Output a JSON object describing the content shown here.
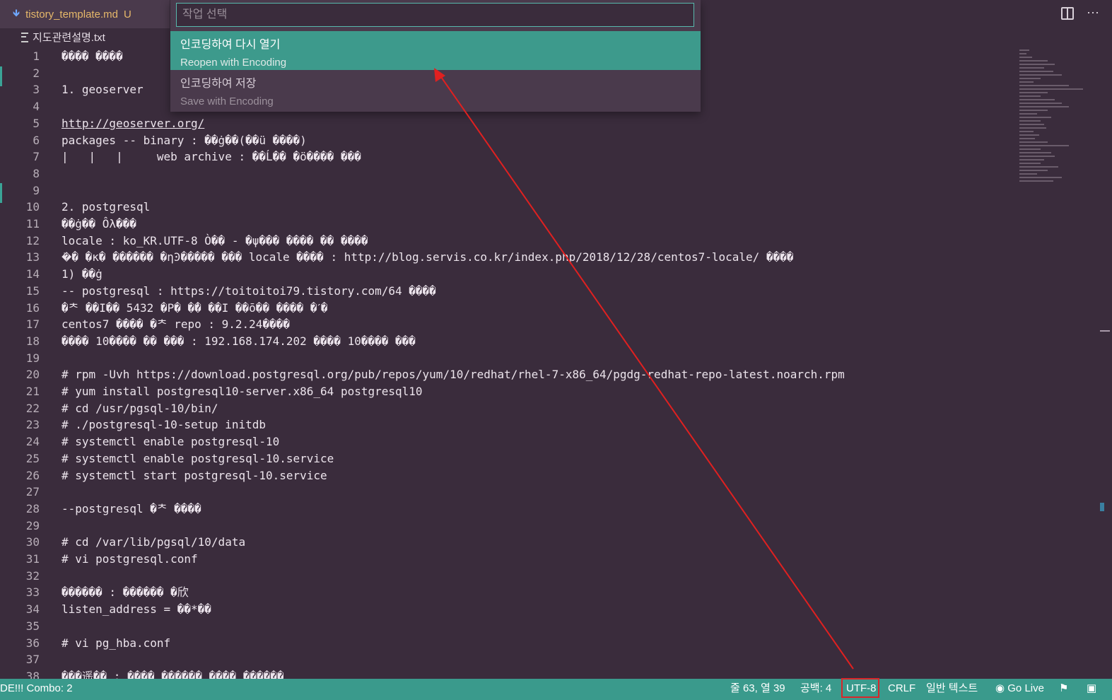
{
  "tab": {
    "filename": "tistory_template.md",
    "badge": "U",
    "icon": "download-arrow-icon"
  },
  "breadcrumb": {
    "filename": "지도관련설명.txt",
    "icon": "text-file-icon"
  },
  "quickpick": {
    "placeholder": "작업 선택",
    "items": [
      {
        "title": "인코딩하여 다시 열기",
        "description": "Reopen with Encoding",
        "selected": true
      },
      {
        "title": "인코딩하여 저장",
        "description": "Save with Encoding",
        "selected": false
      }
    ]
  },
  "editor": {
    "lines": [
      {
        "n": "1",
        "text": "���� ����"
      },
      {
        "n": "2",
        "text": ""
      },
      {
        "n": "3",
        "text": "1. geoserver"
      },
      {
        "n": "4",
        "text": ""
      },
      {
        "n": "5",
        "text": "http://geoserver.org/",
        "link": true
      },
      {
        "n": "6",
        "text": "packages -- binary : ��ġ��(��ü ����)"
      },
      {
        "n": "7",
        "text": "|   |   |     web archive : ��Ĺ�� �ö���� ���"
      },
      {
        "n": "8",
        "text": ""
      },
      {
        "n": "9",
        "text": ""
      },
      {
        "n": "10",
        "text": "2. postgresql"
      },
      {
        "n": "11",
        "text": "��ġ�� Ôλ���"
      },
      {
        "n": "12",
        "text": "locale : ko_KR.UTF-8 Ò�� - �ψ��� ���� �� ����"
      },
      {
        "n": "13",
        "text": "�ܰ� �κ� ������ �ηϿ����� ��� locale ���� : http://blog.servis.co.kr/index.php/2018/12/28/centos7-locale/ ����"
      },
      {
        "n": "14",
        "text": "1) ��ġ"
      },
      {
        "n": "15",
        "text": "-- postgresql : https://toitoitoi79.tistory.com/64 ����"
      },
      {
        "n": "16",
        "text": "�ᄎ ��Ι�� 5432 �Ρ� �ܰ� ��Ι ��ō�� ���� �ˊ�"
      },
      {
        "n": "17",
        "text": "centos7 ���� �ᄎ repo : 9.2.24����"
      },
      {
        "n": "18",
        "text": "���� 10���� �� ��� : 192.168.174.202 ���� 10���� ���"
      },
      {
        "n": "19",
        "text": ""
      },
      {
        "n": "20",
        "text": "# rpm -Uvh https://download.postgresql.org/pub/repos/yum/10/redhat/rhel-7-x86_64/pgdg-redhat-repo-latest.noarch.rpm"
      },
      {
        "n": "21",
        "text": "# yum install postgresql10-server.x86_64 postgresql10"
      },
      {
        "n": "22",
        "text": "# cd /usr/pgsql-10/bin/"
      },
      {
        "n": "23",
        "text": "# ./postgresql-10-setup initdb"
      },
      {
        "n": "24",
        "text": "# systemctl enable postgresql-10"
      },
      {
        "n": "25",
        "text": "# systemctl enable postgresql-10.service"
      },
      {
        "n": "26",
        "text": "# systemctl start postgresql-10.service"
      },
      {
        "n": "27",
        "text": ""
      },
      {
        "n": "28",
        "text": "--postgresql �ᄎ ����"
      },
      {
        "n": "29",
        "text": ""
      },
      {
        "n": "30",
        "text": "# cd /var/lib/pgsql/10/data"
      },
      {
        "n": "31",
        "text": "# vi postgresql.conf"
      },
      {
        "n": "32",
        "text": ""
      },
      {
        "n": "33",
        "text": "������ : ������ �欣"
      },
      {
        "n": "34",
        "text": "listen_address = ��*��"
      },
      {
        "n": "35",
        "text": ""
      },
      {
        "n": "36",
        "text": "# vi pg_hba.conf"
      },
      {
        "n": "37",
        "text": ""
      },
      {
        "n": "38",
        "text": "���遥�� : ���� ������ ���� ������"
      }
    ]
  },
  "status": {
    "left": "DE!!! Combo: 2",
    "position": "줄 63, 열 39",
    "indent": "공백: 4",
    "encoding": "UTF-8",
    "eol": "CRLF",
    "language": "일반 텍스트",
    "golive": "Go Live"
  },
  "annotation": {
    "arrow_color": "#e02020",
    "box_color": "#d9262a"
  }
}
